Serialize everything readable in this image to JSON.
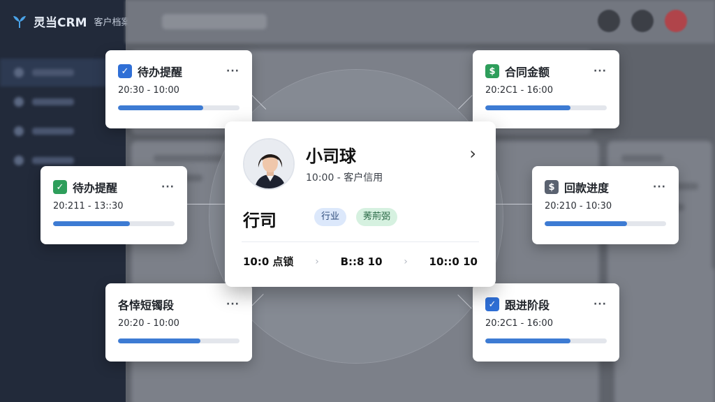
{
  "app": {
    "brand_name": "灵当CRM",
    "brand_subtitle": "客户档案"
  },
  "profile": {
    "name": "小司球",
    "subtitle": "10:00 - 客户信用",
    "company": "行司",
    "tags": [
      "行业",
      "莠荊弼"
    ],
    "stats": [
      "10:0 点锁",
      "B::8 10",
      "10::0 10"
    ]
  },
  "cards": [
    {
      "title": "待办提醒",
      "time": "20:30 - 10:00",
      "icon": "checkbox-checked-icon",
      "icon_color": "#2f6fd6",
      "progress": 0.7
    },
    {
      "title": "待办提醒",
      "time": "20:211 - 13::30",
      "icon": "checkbox-checked-icon",
      "icon_color": "#2e9e5b",
      "progress": 0.63
    },
    {
      "title": "各悻短镯段",
      "time": "20:20 - 10:00",
      "icon": "none",
      "icon_color": "",
      "progress": 0.68
    },
    {
      "title": "合同金额",
      "time": "20:2C1 - 16:00",
      "icon": "dollar-icon",
      "icon_color": "#2e9e5b",
      "progress": 0.7
    },
    {
      "title": "回款进度",
      "time": "20:210 - 10:30",
      "icon": "dollar-icon",
      "icon_color": "#5a6270",
      "progress": 0.68
    },
    {
      "title": "跟进阶段",
      "time": "20:2C1 - 16:00",
      "icon": "checkbox-checked-icon",
      "icon_color": "#2f6fd6",
      "progress": 0.7
    }
  ],
  "colors": {
    "progress_fill": "#3d7bd3",
    "sidebar_bg": "#222a3a"
  }
}
